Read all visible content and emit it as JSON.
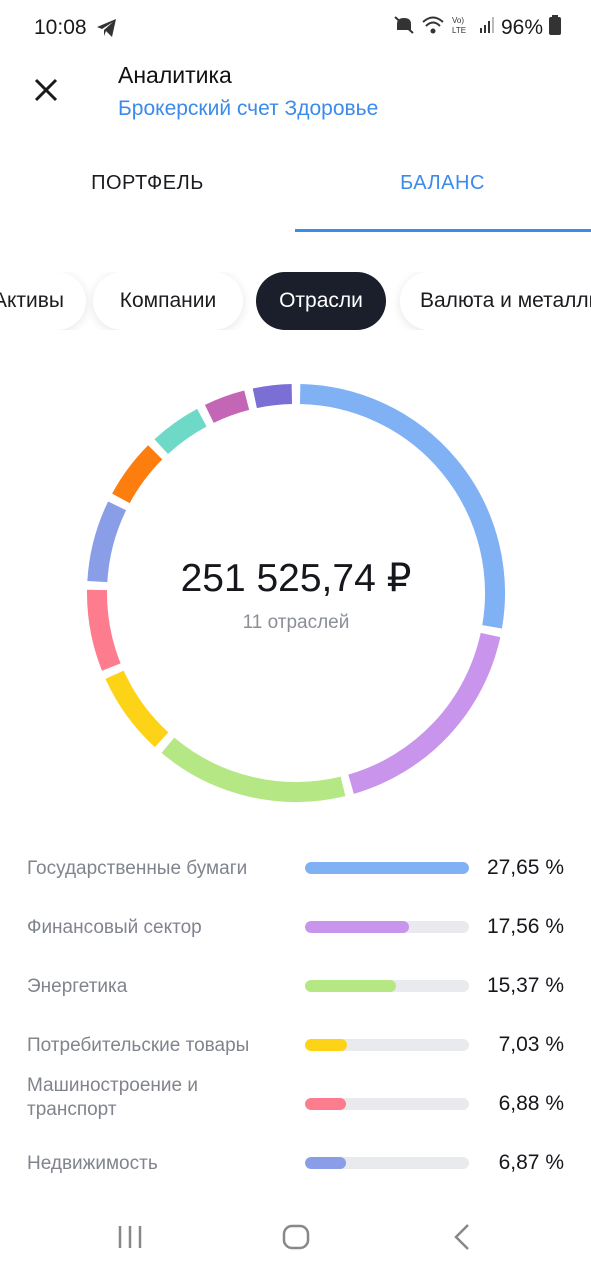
{
  "status": {
    "time": "10:08",
    "battery": "96%",
    "network": "LTE"
  },
  "header": {
    "title": "Аналитика",
    "subtitle": "Брокерский счет Здоровье"
  },
  "tabs": [
    {
      "label": "ПОРТФЕЛЬ",
      "active": false
    },
    {
      "label": "БАЛАНС",
      "active": true
    }
  ],
  "chips": [
    {
      "label": "Активы",
      "selected": false
    },
    {
      "label": "Компании",
      "selected": false
    },
    {
      "label": "Отрасли",
      "selected": true
    },
    {
      "label": "Валюта и металлы",
      "selected": false
    }
  ],
  "summary": {
    "total": "251 525,74 ₽",
    "count_text": "11 отраслей"
  },
  "colors": {
    "accent": "#3b8bea",
    "chip_active": "#1b1f2b",
    "track": "#e9eaed"
  },
  "chart_data": {
    "type": "pie",
    "total": "251 525,74 ₽",
    "segments": [
      {
        "name": "Государственные бумаги",
        "value": 27.65,
        "label": "27,65 %",
        "color": "#7fb1f4"
      },
      {
        "name": "Финансовый сектор",
        "value": 17.56,
        "label": "17,56 %",
        "color": "#c995ec"
      },
      {
        "name": "Энергетика",
        "value": 15.37,
        "label": "15,37 %",
        "color": "#b6e785"
      },
      {
        "name": "Потребительские товары",
        "value": 7.03,
        "label": "7,03 %",
        "color": "#fdd317"
      },
      {
        "name": "Машиностроение и транспорт",
        "value": 6.88,
        "label": "6,88 %",
        "color": "#fd7c8d"
      },
      {
        "name": "Недвижимость",
        "value": 6.87,
        "label": "6,87 %",
        "color": "#8a9ee8"
      },
      {
        "value": 5.2,
        "color": "#fd7e0f"
      },
      {
        "value": 4.6,
        "color": "#6ed9c6"
      },
      {
        "value": 3.8,
        "color": "#c266b5"
      },
      {
        "value": 3.6,
        "color": "#7b6fd6"
      }
    ]
  }
}
